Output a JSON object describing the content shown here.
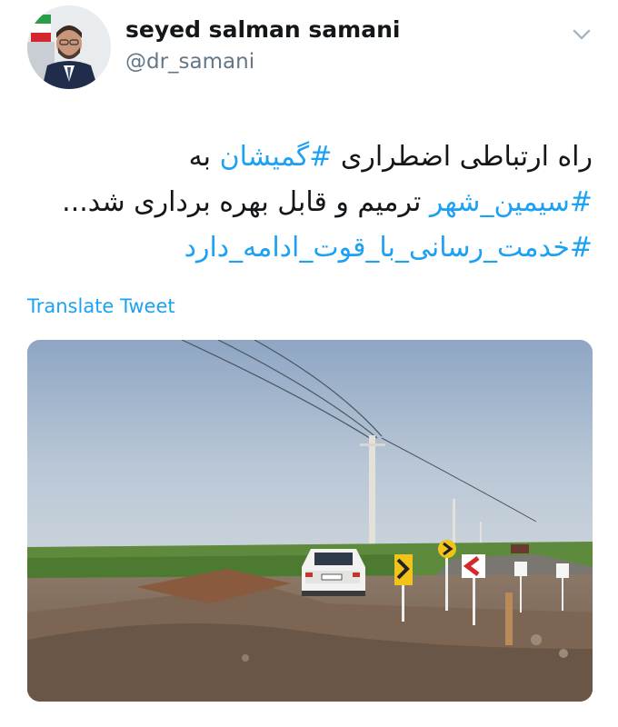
{
  "author": {
    "name": "seyed salman samani",
    "handle": "@dr_samani",
    "avatar_icon": "profile-photo"
  },
  "menu": {
    "icon": "chevron-down-icon"
  },
  "tweet": {
    "line1_prefix": "راه ارتباطی اضطراری ",
    "line1_hashtag": "#گمیشان",
    "line1_suffix": " به",
    "line2_hashtag": "#سیمین_شهر",
    "line2_suffix": " ترمیم و قابل بهره برداری شد...",
    "line3_hashtag": "#خدمت_رسانی_با_قوت_ادامه_دارد"
  },
  "translate_label": "Translate Tweet",
  "colors": {
    "link": "#1da1f2",
    "text": "#14171a",
    "secondary": "#657786"
  }
}
